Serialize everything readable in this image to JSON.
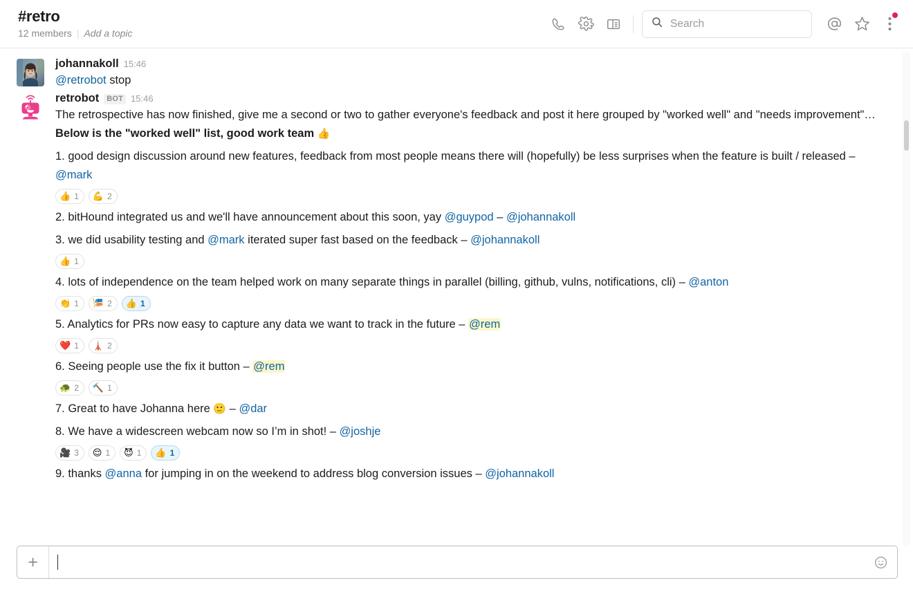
{
  "header": {
    "channel_name": "#retro",
    "members": "12 members",
    "divider": "|",
    "add_topic": "Add a topic",
    "icons": [
      "phone-icon",
      "gear-icon",
      "panel-icon",
      "at-icon",
      "star-icon",
      "kebab-icon"
    ],
    "notification_dot_color": "#e01e5a"
  },
  "search": {
    "placeholder": "Search",
    "value": ""
  },
  "messages": [
    {
      "author": "johannakoll",
      "time": "15:46",
      "is_bot": false,
      "avatar": "photo-avatar",
      "blocks": [
        {
          "type": "text",
          "parts": [
            {
              "kind": "mention",
              "text": "@retrobot"
            },
            {
              "kind": "plain",
              "text": " stop"
            }
          ]
        }
      ]
    },
    {
      "author": "retrobot",
      "bot_label": "BOT",
      "time": "15:46",
      "is_bot": true,
      "avatar": "retrobot-avatar",
      "blocks": [
        {
          "type": "text",
          "parts": [
            {
              "kind": "plain",
              "text": "The retrospective has now finished, give me a second or two to gather everyone's feedback and post it here grouped by \"worked well\" and \"needs improvement\"…"
            }
          ]
        },
        {
          "type": "text",
          "bold": true,
          "parts": [
            {
              "kind": "plain",
              "text": "Below is the \"worked well\" list, good work team "
            },
            {
              "kind": "emoji",
              "text": "👍",
              "name": "thumbsup-emoji"
            }
          ]
        },
        {
          "type": "text",
          "item": true,
          "parts": [
            {
              "kind": "plain",
              "text": "1. good design discussion around new features, feedback from most people means there will (hopefully) be less surprises when the feature is built / released – "
            },
            {
              "kind": "mention",
              "text": "@mark"
            }
          ]
        },
        {
          "type": "reactions",
          "items": [
            {
              "emoji": "👍",
              "name": "thumbsup-reaction",
              "count": "1",
              "mine": false
            },
            {
              "emoji": "💪",
              "name": "muscle-reaction",
              "count": "2",
              "mine": false
            }
          ]
        },
        {
          "type": "text",
          "item": true,
          "parts": [
            {
              "kind": "plain",
              "text": "2. bitHound integrated us and we'll have announcement about this soon, yay "
            },
            {
              "kind": "mention",
              "text": "@guypod"
            },
            {
              "kind": "plain",
              "text": " – "
            },
            {
              "kind": "mention",
              "text": "@johannakoll"
            }
          ]
        },
        {
          "type": "text",
          "item": true,
          "parts": [
            {
              "kind": "plain",
              "text": "3. we did usability testing and "
            },
            {
              "kind": "mention",
              "text": "@mark"
            },
            {
              "kind": "plain",
              "text": " iterated super fast based on the feedback – "
            },
            {
              "kind": "mention",
              "text": "@johannakoll"
            }
          ]
        },
        {
          "type": "reactions",
          "items": [
            {
              "emoji": "👍",
              "name": "thumbsup-reaction",
              "count": "1",
              "mine": false
            }
          ]
        },
        {
          "type": "text",
          "item": true,
          "parts": [
            {
              "kind": "plain",
              "text": "4. lots of independence on the team helped work on many separate things in parallel (billing, github, vulns, notifications, cli) – "
            },
            {
              "kind": "mention",
              "text": "@anton"
            }
          ]
        },
        {
          "type": "reactions",
          "items": [
            {
              "emoji": "👏",
              "name": "clap-reaction",
              "count": "1",
              "mine": false
            },
            {
              "emoji": "🎏",
              "name": "carp-streamer-reaction",
              "count": "2",
              "mine": false
            },
            {
              "emoji": "👍",
              "name": "thumbsup-reaction",
              "count": "1",
              "mine": true
            }
          ]
        },
        {
          "type": "text",
          "item": true,
          "parts": [
            {
              "kind": "plain",
              "text": "5. Analytics for PRs now easy to capture any data we want to track in the future – "
            },
            {
              "kind": "mention-self",
              "text": "@rem"
            }
          ]
        },
        {
          "type": "reactions",
          "items": [
            {
              "emoji": "❤️",
              "name": "heart-reaction",
              "count": "1",
              "mine": false
            },
            {
              "emoji": "🗼",
              "name": "tokyo-tower-reaction",
              "count": "2",
              "mine": false
            }
          ]
        },
        {
          "type": "text",
          "item": true,
          "parts": [
            {
              "kind": "plain",
              "text": "6. Seeing people use the fix it button – "
            },
            {
              "kind": "mention-self",
              "text": "@rem"
            }
          ]
        },
        {
          "type": "reactions",
          "items": [
            {
              "emoji": "🐢",
              "name": "turtle-reaction",
              "count": "2",
              "mine": false
            },
            {
              "emoji": "🔨",
              "name": "hammer-reaction",
              "count": "1",
              "mine": false
            }
          ]
        },
        {
          "type": "text",
          "item": true,
          "parts": [
            {
              "kind": "plain",
              "text": "7. Great to have Johanna here "
            },
            {
              "kind": "emoji",
              "text": "🙂",
              "name": "slightly-smiling-emoji"
            },
            {
              "kind": "plain",
              "text": " – "
            },
            {
              "kind": "mention",
              "text": "@dar"
            }
          ]
        },
        {
          "type": "text",
          "item": true,
          "parts": [
            {
              "kind": "plain",
              "text": "8. We have a widescreen webcam now so I’m in shot! – "
            },
            {
              "kind": "mention",
              "text": "@joshje"
            }
          ]
        },
        {
          "type": "reactions",
          "items": [
            {
              "emoji": "🎥",
              "name": "movie-camera-reaction",
              "count": "3",
              "mine": false
            },
            {
              "emoji": "😌",
              "name": "relieved-reaction",
              "count": "1",
              "mine": false
            },
            {
              "emoji": "😈",
              "name": "imp-reaction",
              "count": "1",
              "mine": false
            },
            {
              "emoji": "👍",
              "name": "thumbsup-reaction",
              "count": "1",
              "mine": true
            }
          ]
        },
        {
          "type": "text",
          "item": true,
          "parts": [
            {
              "kind": "plain",
              "text": "9. thanks "
            },
            {
              "kind": "mention",
              "text": "@anna"
            },
            {
              "kind": "plain",
              "text": " for jumping in on the weekend to address blog conversion issues – "
            },
            {
              "kind": "mention",
              "text": "@johannakoll"
            }
          ]
        }
      ]
    }
  ],
  "composer": {
    "plus_label": "+",
    "value": "",
    "placeholder": "",
    "emoji_icon": "smiley-icon"
  }
}
